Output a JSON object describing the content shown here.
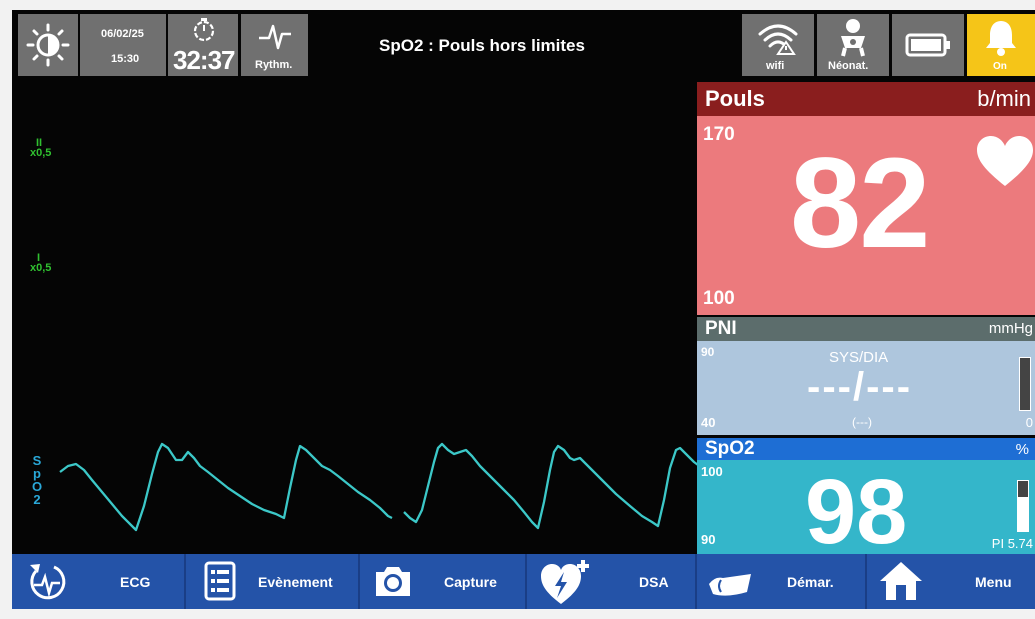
{
  "topbar": {
    "date": "06/02/25",
    "time": "15:30",
    "timer": "32:37",
    "rhythm_label": "Rythm.",
    "alarm_message": "SpO2 : Pouls hors limites",
    "wifi_label": "wifi",
    "neonat_label": "Néonat.",
    "alarm_label": "On",
    "icons": [
      "brightness-icon",
      "timer-icon",
      "rhythm-icon",
      "wifi-icon",
      "baby-icon",
      "battery-icon",
      "bell-icon"
    ]
  },
  "channels": {
    "lead_ii": {
      "lead": "II",
      "gain": "x0,5"
    },
    "lead_i": {
      "lead": "I",
      "gain": "x0,5"
    },
    "spo2_letters": [
      "S",
      "p",
      "O",
      "2"
    ]
  },
  "pouls": {
    "title": "Pouls",
    "unit": "b/min",
    "high_limit": "170",
    "low_limit": "100",
    "value": "82"
  },
  "pni": {
    "title": "PNI",
    "unit": "mmHg",
    "high_limit": "90",
    "low_limit": "40",
    "mode_label": "SYS/DIA",
    "value": "---/---",
    "mean": "(---)",
    "bar_min": "0"
  },
  "spo2": {
    "title": "SpO2",
    "unit": "%",
    "high_limit": "100",
    "low_limit": "90",
    "value": "98",
    "pi": "PI 5.74"
  },
  "bottombar": {
    "ecg_label": "ECG",
    "event_label": "Evènement",
    "capture_label": "Capture",
    "dsa_label": "DSA",
    "start_label": "Démar.",
    "menu_label": "Menu"
  },
  "colors": {
    "pouls_bg": "#ec7a7d",
    "pni_bg": "#aec6dd",
    "spo2_bg": "#34b6ca",
    "waveform": "#3cc8c8",
    "ecg_labels": "#30c030",
    "alarm_on": "#f5c518",
    "bottombar": "#2453a8"
  }
}
